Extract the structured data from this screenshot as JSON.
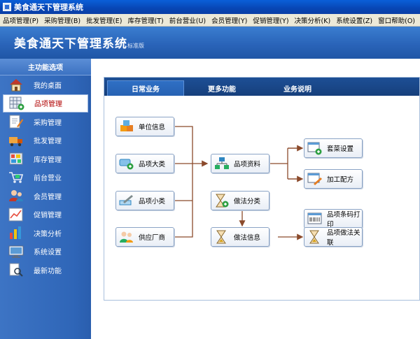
{
  "window": {
    "title": "美食通天下管理系统"
  },
  "menu": [
    "品项管理(P)",
    "采购管理(B)",
    "批发管理(E)",
    "库存管理(T)",
    "前台营业(U)",
    "会员管理(Y)",
    "促销管理(Y)",
    "决策分析(K)",
    "系统设置(Z)",
    "窗口帮助(O)"
  ],
  "header": {
    "title": "美食通天下管理系统",
    "edition": "标准版"
  },
  "sidebar": {
    "heading": "主功能选项",
    "items": [
      {
        "label": "我的桌面",
        "icon": "house-icon"
      },
      {
        "label": "品项管理",
        "icon": "grid-add-icon",
        "active": true
      },
      {
        "label": "采购管理",
        "icon": "document-pen-icon"
      },
      {
        "label": "批发管理",
        "icon": "truck-icon"
      },
      {
        "label": "库存管理",
        "icon": "shelf-icon"
      },
      {
        "label": "前台营业",
        "icon": "cart-icon"
      },
      {
        "label": "会员管理",
        "icon": "members-icon"
      },
      {
        "label": "促销管理",
        "icon": "chart-line-icon"
      },
      {
        "label": "决策分析",
        "icon": "bar-chart-icon"
      },
      {
        "label": "系统设置",
        "icon": "monitor-icon"
      },
      {
        "label": "最新功能",
        "icon": "magnifier-doc-icon"
      }
    ]
  },
  "tabs": [
    "日常业务",
    "更多功能",
    "业务说明"
  ],
  "flow": {
    "unit_info": "单位信息",
    "category_major": "品项大类",
    "category_minor": "品项小类",
    "supplier": "供应厂商",
    "item_data": "品项资料",
    "method_class": "做法分类",
    "method_info": "做法信息",
    "package_set": "套菜设置",
    "recipe": "加工配方",
    "barcode_print": "品项条码打印",
    "method_link": "品项做法关联"
  },
  "colors": {
    "accent": "#2a64b9",
    "connector": "#8b4a2b",
    "active_text": "#b00000"
  }
}
